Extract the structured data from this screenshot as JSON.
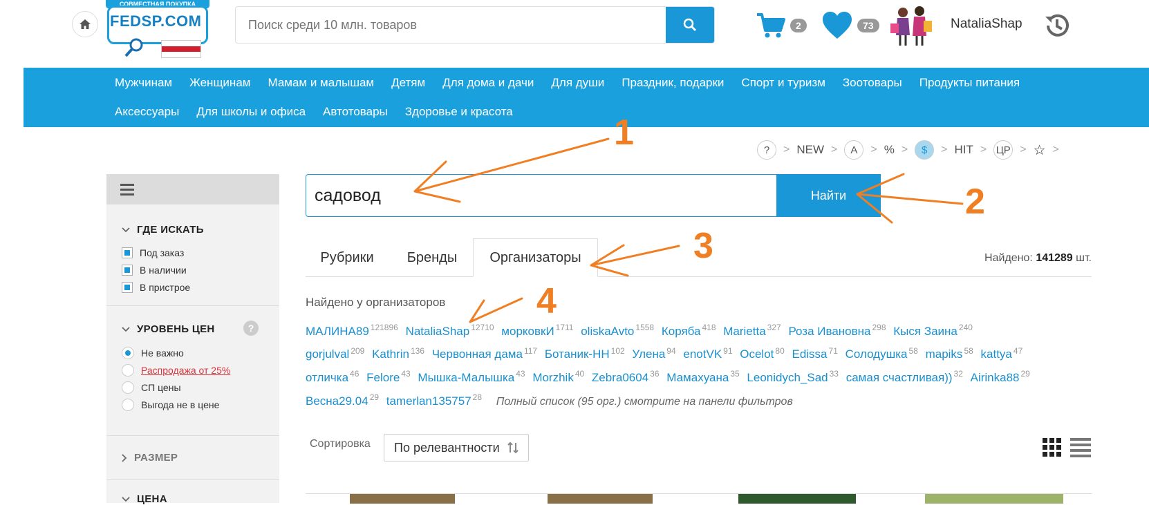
{
  "header": {
    "logo_top": "СОВМЕСТНАЯ ПОКУПКА",
    "logo_text": "FEDSP.COM",
    "search_placeholder": "Поиск среди 10 млн. товаров",
    "cart_count": "2",
    "favorites_count": "73",
    "user_name": "NataliaShap"
  },
  "nav": {
    "row1": [
      "Мужчинам",
      "Женщинам",
      "Мамам и малышам",
      "Детям",
      "Для дома и дачи",
      "Для души",
      "Праздник, подарки",
      "Спорт и туризм",
      "Зоотовары",
      "Продукты питания"
    ],
    "row2": [
      "Аксессуары",
      "Для школы и офиса",
      "Автотовары",
      "Здоровье и красота"
    ]
  },
  "filter_strip": [
    "?",
    "NEW",
    "A",
    "%",
    "$",
    "HIT",
    "ЦР",
    "☆"
  ],
  "sidebar": {
    "where_title": "ГДЕ ИСКАТЬ",
    "where_items": [
      "Под заказ",
      "В наличии",
      "В пристрое"
    ],
    "price_title": "УРОВЕНЬ ЦЕН",
    "price_items": [
      "Не важно",
      "Распродажа от 25%",
      "СП цены",
      "Выгода не в цене"
    ],
    "size_title": "РАЗМЕР",
    "cost_title": "ЦЕНА"
  },
  "search": {
    "query": "садовод",
    "button": "Найти"
  },
  "tabs": [
    "Рубрики",
    "Бренды",
    "Организаторы"
  ],
  "found_label": "Найдено:",
  "found_count": "141289",
  "found_unit": "шт.",
  "org_title": "Найдено у организаторов",
  "organizers": [
    {
      "name": "МАЛИНА89",
      "count": "121896"
    },
    {
      "name": "NataliaShap",
      "count": "12710"
    },
    {
      "name": "морковкИ",
      "count": "1711"
    },
    {
      "name": "oliskaAvto",
      "count": "1558"
    },
    {
      "name": "Коряба",
      "count": "418"
    },
    {
      "name": "Marietta",
      "count": "327"
    },
    {
      "name": "Роза Ивановна",
      "count": "298"
    },
    {
      "name": "Кыся Заина",
      "count": "240"
    },
    {
      "name": "gorjulval",
      "count": "209"
    },
    {
      "name": "Kathrin",
      "count": "136"
    },
    {
      "name": "Червонная дама",
      "count": "117"
    },
    {
      "name": "Ботаник-НН",
      "count": "102"
    },
    {
      "name": "Улена",
      "count": "94"
    },
    {
      "name": "enotVK",
      "count": "91"
    },
    {
      "name": "Ocelot",
      "count": "80"
    },
    {
      "name": "Edissa",
      "count": "71"
    },
    {
      "name": "Солодушка",
      "count": "58"
    },
    {
      "name": "mapiks",
      "count": "58"
    },
    {
      "name": "kattya",
      "count": "47"
    },
    {
      "name": "отличка",
      "count": "46"
    },
    {
      "name": "Felore",
      "count": "43"
    },
    {
      "name": "Мышка-Малышка",
      "count": "43"
    },
    {
      "name": "Morzhik",
      "count": "40"
    },
    {
      "name": "Zebra0604",
      "count": "36"
    },
    {
      "name": "Мамахуана",
      "count": "35"
    },
    {
      "name": "Leonidych_Sad",
      "count": "33"
    },
    {
      "name": "самая счастливая))",
      "count": "32"
    },
    {
      "name": "Airinka88",
      "count": "29"
    },
    {
      "name": "Весна29.04",
      "count": "29"
    },
    {
      "name": "tamerlan135757",
      "count": "28"
    }
  ],
  "org_note": "Полный список (95 орг.) смотрите на панели фильтров",
  "sort": {
    "label": "Сортировка",
    "value": "По релевантности"
  },
  "annotations": [
    "1",
    "2",
    "3",
    "4"
  ],
  "colors": {
    "accent": "#1aa0dd",
    "annotation": "#f07f24"
  }
}
